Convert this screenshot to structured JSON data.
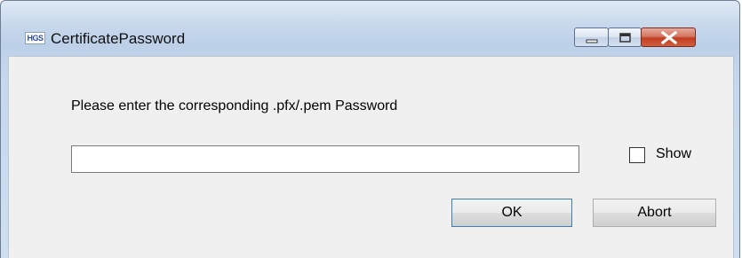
{
  "window": {
    "title": "CertificatePassword",
    "icon": {
      "name": "app-logo-icon",
      "text": "HGS"
    }
  },
  "title_controls": {
    "minimize": "minimize-icon",
    "maximize": "maximize-icon",
    "close": "close-icon"
  },
  "form": {
    "prompt": "Please enter the corresponding .pfx/.pem Password",
    "password_value": "",
    "show_label": "Show",
    "show_checked": false
  },
  "buttons": {
    "ok": "OK",
    "abort": "Abort"
  },
  "colors": {
    "close_button": "#c13d22",
    "client_background": "#f0f0f0"
  }
}
